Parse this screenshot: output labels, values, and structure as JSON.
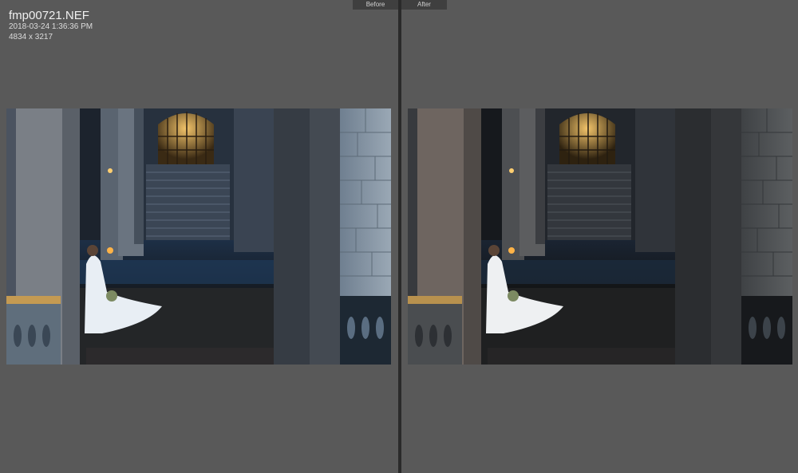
{
  "compare": {
    "before_label": "Before",
    "after_label": "After"
  },
  "image_info": {
    "filename": "fmp00721.NEF",
    "datetime": "2018-03-24 1:36:36 PM",
    "dimensions": "4834 x 3217"
  },
  "colors": {
    "background": "#595959",
    "divider": "#2a2a2a",
    "label_bg": "#3f3f3f"
  }
}
